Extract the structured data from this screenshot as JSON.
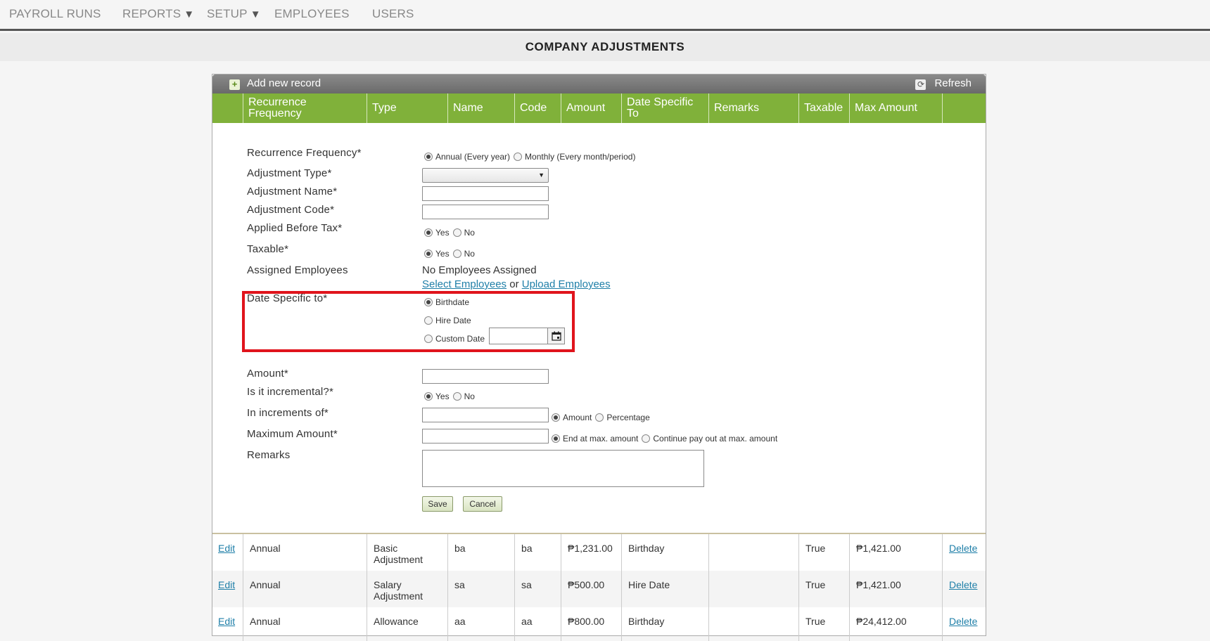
{
  "nav": {
    "items": [
      {
        "label": "PAYROLL RUNS",
        "caret": ""
      },
      {
        "label": "REPORTS",
        "caret": "▼"
      },
      {
        "label": "SETUP",
        "caret": "▼"
      },
      {
        "label": "EMPLOYEES",
        "caret": ""
      },
      {
        "label": "USERS",
        "caret": ""
      }
    ]
  },
  "page_title": "COMPANY ADJUSTMENTS",
  "toolbar": {
    "add_label": "Add new record",
    "add_icon": "+",
    "refresh_label": "Refresh",
    "refresh_icon": "⟳"
  },
  "columns": [
    {
      "line1": "",
      "line2": ""
    },
    {
      "line1": "Recurrence",
      "line2": "Frequency"
    },
    {
      "line1": "Type",
      "line2": ""
    },
    {
      "line1": "Name",
      "line2": ""
    },
    {
      "line1": "Code",
      "line2": ""
    },
    {
      "line1": "Amount",
      "line2": ""
    },
    {
      "line1": "Date Specific",
      "line2": "To"
    },
    {
      "line1": "Remarks",
      "line2": ""
    },
    {
      "line1": "Taxable",
      "line2": ""
    },
    {
      "line1": "Max Amount",
      "line2": ""
    },
    {
      "line1": "",
      "line2": ""
    }
  ],
  "form": {
    "recurrence": {
      "label": "Recurrence Frequency*",
      "opt1": "Annual (Every year)",
      "opt2": "Monthly (Every month/period)",
      "selected": "Annual (Every year)"
    },
    "adj_type": {
      "label": "Adjustment Type*",
      "value": ""
    },
    "adj_name": {
      "label": "Adjustment Name*",
      "value": ""
    },
    "adj_code": {
      "label": "Adjustment Code*",
      "value": ""
    },
    "before_tax": {
      "label": "Applied Before Tax*",
      "opt1": "Yes",
      "opt2": "No",
      "selected": "Yes"
    },
    "taxable": {
      "label": "Taxable*",
      "opt1": "Yes",
      "opt2": "No",
      "selected": "Yes"
    },
    "assigned": {
      "label": "Assigned Employees",
      "value": "No Employees Assigned",
      "select_link": "Select Employees",
      "or": "or",
      "upload_link": "Upload Employees"
    },
    "date_specific": {
      "label": "Date Specific to*",
      "opt1": "Birthdate",
      "opt2": "Hire Date",
      "opt3": "Custom Date",
      "selected": "Birthdate",
      "custom_value": ""
    },
    "amount": {
      "label": "Amount*",
      "value": ""
    },
    "incremental": {
      "label": "Is it incremental?*",
      "opt1": "Yes",
      "opt2": "No",
      "selected": "Yes"
    },
    "increments": {
      "label": "In increments of*",
      "value": "",
      "opt1": "Amount",
      "opt2": "Percentage",
      "selected": "Amount"
    },
    "max_amount": {
      "label": "Maximum Amount*",
      "value": "",
      "opt1": "End at max. amount",
      "opt2": "Continue pay out at max. amount",
      "selected": "End at max. amount"
    },
    "remarks": {
      "label": "Remarks",
      "value": ""
    },
    "save_label": "Save",
    "cancel_label": "Cancel"
  },
  "rows": [
    {
      "edit": "Edit",
      "frequency": "Annual",
      "type": "Basic Adjustment",
      "name": "ba",
      "code": "ba",
      "amount": "₱1,231.00",
      "date_specific": "Birthday",
      "remarks": "",
      "taxable": "True",
      "max_amount": "₱1,421.00",
      "delete": "Delete"
    },
    {
      "edit": "Edit",
      "frequency": "Annual",
      "type": "Salary Adjustment",
      "name": "sa",
      "code": "sa",
      "amount": "₱500.00",
      "date_specific": "Hire Date",
      "remarks": "",
      "taxable": "True",
      "max_amount": "₱1,421.00",
      "delete": "Delete"
    },
    {
      "edit": "Edit",
      "frequency": "Annual",
      "type": "Allowance",
      "name": "aa",
      "code": "aa",
      "amount": "₱800.00",
      "date_specific": "Birthday",
      "remarks": "",
      "taxable": "True",
      "max_amount": "₱24,412.00",
      "delete": "Delete"
    }
  ],
  "colors": {
    "header_green": "#80b13a",
    "link": "#1f7fa8",
    "highlight": "#e0141c"
  }
}
